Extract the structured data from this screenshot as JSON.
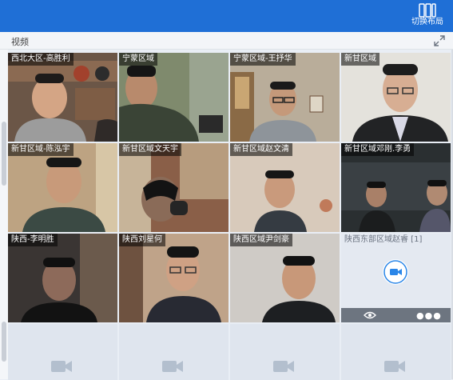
{
  "toolbar": {
    "switch_layout_label": "切换布局"
  },
  "panel": {
    "title": "视频"
  },
  "tiles": [
    {
      "name": "西北大区-高胜利"
    },
    {
      "name": "宁蒙区域"
    },
    {
      "name": "宁蒙区域-王抒华"
    },
    {
      "name": "新甘区域"
    },
    {
      "name": "新甘区域-陈泓宇"
    },
    {
      "name": "新甘区域文天宇"
    },
    {
      "name": "新甘区域赵文清"
    },
    {
      "name": "新甘区域邓刚.李勇"
    },
    {
      "name": "陕西-李明胜"
    },
    {
      "name": "陕西刘星何"
    },
    {
      "name": "陕西区域尹剑豪"
    },
    {
      "name": "陕西东部区域赵睿 [1]"
    }
  ],
  "colors": {
    "accent": "#1f6fd6",
    "camera_off_icon": "#2a86e8"
  },
  "icons": [
    "layout-switch-icon",
    "expand-icon",
    "camera-icon",
    "eye-icon",
    "more-icon"
  ]
}
